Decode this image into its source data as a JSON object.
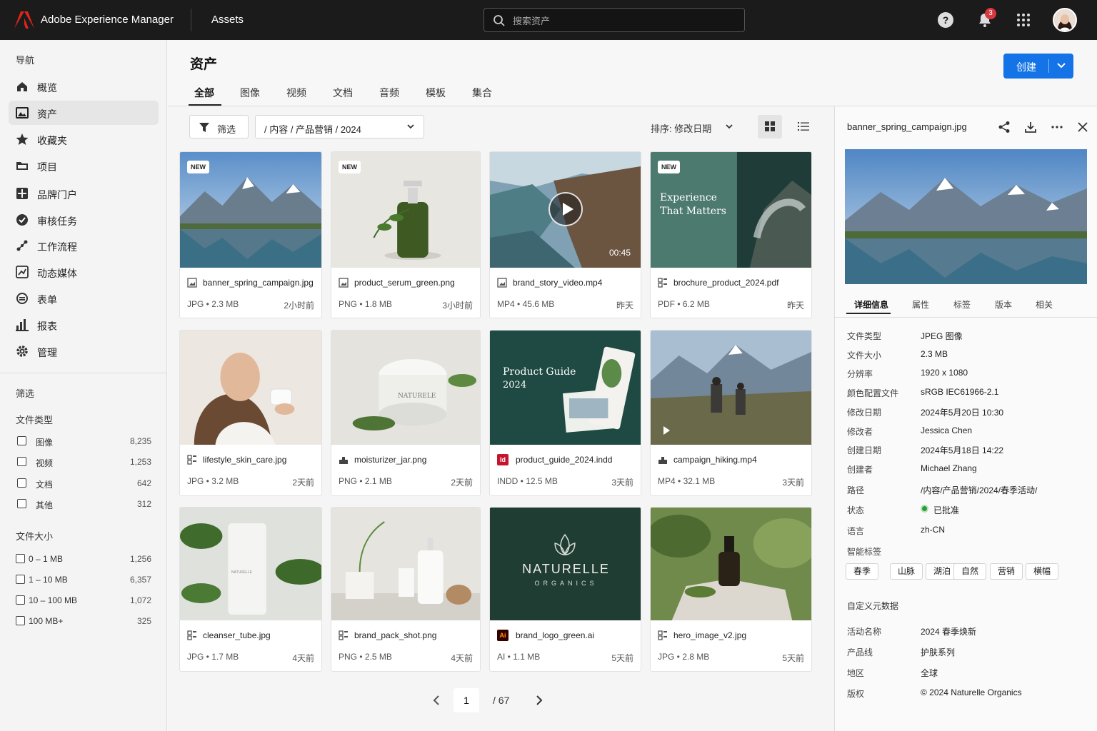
{
  "topbar": {
    "brand": "Adobe Experience Manager",
    "app": "Assets",
    "search_placeholder": "搜索资产",
    "help": "?",
    "notifications": "3"
  },
  "sidebar": {
    "nav_title": "导航",
    "nav": [
      {
        "label": "概览",
        "icon": "overview-icon"
      },
      {
        "label": "资产",
        "icon": "assets-icon"
      },
      {
        "label": "收藏夹",
        "icon": "star-icon"
      },
      {
        "label": "项目",
        "icon": "folder-icon"
      },
      {
        "label": "品牌门户",
        "icon": "brand-portal-icon"
      },
      {
        "label": "审核任务",
        "icon": "check-circle-icon"
      },
      {
        "label": "工作流程",
        "icon": "workflow-icon"
      },
      {
        "label": "动态媒体",
        "icon": "dynamic-media-icon"
      },
      {
        "label": "表单",
        "icon": "form-icon"
      },
      {
        "label": "报表",
        "icon": "report-icon"
      },
      {
        "label": "管理",
        "icon": "gear-icon"
      }
    ],
    "filter_title": "筛选",
    "file_type_title": "文件类型",
    "file_types": [
      {
        "label": "图像",
        "count": "8,235"
      },
      {
        "label": "视频",
        "count": "1,253"
      },
      {
        "label": "文档",
        "count": "642"
      },
      {
        "label": "其他",
        "count": "312"
      }
    ],
    "file_size_title": "文件大小",
    "file_sizes": [
      {
        "label": "0 – 1 MB",
        "count": "1,256"
      },
      {
        "label": "1 – 10 MB",
        "count": "6,357"
      },
      {
        "label": "10 – 100 MB",
        "count": "1,072"
      },
      {
        "label": "100 MB+",
        "count": "325"
      }
    ]
  },
  "header": {
    "title": "资产",
    "create": "创建",
    "tabs": [
      "全部",
      "图像",
      "视频",
      "文档",
      "音频",
      "模板",
      "集合"
    ]
  },
  "toolbar": {
    "filter": "筛选",
    "path": "/ 内容 / 产品营销 / 2024",
    "sort": "排序:  修改日期"
  },
  "assets": [
    {
      "name": "banner_spring_campaign.jpg",
      "type": "JPG",
      "size": "2.3 MB",
      "time": "2小时前",
      "badge": "NEW"
    },
    {
      "name": "product_serum_green.png",
      "type": "PNG",
      "size": "1.8 MB",
      "time": "3小时前",
      "badge": "NEW"
    },
    {
      "name": "brand_story_video.mp4",
      "type": "MP4",
      "size": "45.6 MB",
      "time": "昨天",
      "duration": "00:45"
    },
    {
      "name": "brochure_product_2024.pdf",
      "type": "PDF",
      "size": "6.2 MB",
      "time": "昨天",
      "badge": "NEW",
      "thumb_text": [
        "Experience",
        "That Matters"
      ]
    },
    {
      "name": "lifestyle_skin_care.jpg",
      "type": "JPG",
      "size": "3.2 MB",
      "time": "2天前"
    },
    {
      "name": "moisturizer_jar.png",
      "type": "PNG",
      "size": "2.1 MB",
      "time": "2天前",
      "thumb_text": [
        "NATURELE"
      ]
    },
    {
      "name": "product_guide_2024.indd",
      "type": "INDD",
      "size": "12.5 MB",
      "time": "3天前",
      "thumb_text": [
        "Product Guide",
        "2024"
      ],
      "icon_text": "Id"
    },
    {
      "name": "campaign_hiking.mp4",
      "type": "MP4",
      "size": "32.1 MB",
      "time": "3天前"
    },
    {
      "name": "cleanser_tube.jpg",
      "type": "JPG",
      "size": "1.7 MB",
      "time": "4天前",
      "thumb_text": [
        "NATURELLE"
      ]
    },
    {
      "name": "brand_pack_shot.png",
      "type": "PNG",
      "size": "2.5 MB",
      "time": "4天前"
    },
    {
      "name": "brand_logo_green.ai",
      "type": "AI",
      "size": "1.1 MB",
      "time": "5天前",
      "thumb_text": [
        "NATURELLE",
        "ORGANICS"
      ],
      "icon_text": "Ai"
    },
    {
      "name": "hero_image_v2.jpg",
      "type": "JPG",
      "size": "2.8 MB",
      "time": "5天前"
    }
  ],
  "pagination": {
    "current": "1",
    "total": "/   67"
  },
  "details": {
    "file_name": "banner_spring_campaign.jpg",
    "tabs": [
      "详细信息",
      "属性",
      "标签",
      "版本",
      "相关"
    ],
    "props": [
      {
        "k": "文件类型",
        "v": "JPEG 图像"
      },
      {
        "k": "文件大小",
        "v": "2.3 MB"
      },
      {
        "k": "分辨率",
        "v": "1920 x 1080"
      },
      {
        "k": "颜色配置文件",
        "v": "sRGB IEC61966-2.1"
      },
      {
        "k": "修改日期",
        "v": "2024年5月20日 10:30"
      },
      {
        "k": "修改者",
        "v": "Jessica Chen"
      },
      {
        "k": "创建日期",
        "v": "2024年5月18日 14:22"
      },
      {
        "k": "创建者",
        "v": "Michael Zhang"
      },
      {
        "k": "路径",
        "v": "/内容/产品营销/2024/春季活动/"
      },
      {
        "k": "状态",
        "v": "已批准"
      },
      {
        "k": "语言",
        "v": "zh-CN"
      }
    ],
    "smart_tags_title": "智能标签",
    "smart_tags": [
      "春季",
      "山脉",
      "湖泊",
      "自然",
      "营销",
      "横幅"
    ],
    "custom_title": "自定义元数据",
    "custom": [
      {
        "k": "活动名称",
        "v": "2024 春季焕新"
      },
      {
        "k": "产品线",
        "v": "护肤系列"
      },
      {
        "k": "地区",
        "v": "全球"
      },
      {
        "k": "版权",
        "v": "© 2024 Naturelle Organics"
      }
    ],
    "status_color": "#2d9d3a"
  },
  "colors": {
    "accent": "#1473e6",
    "topbar": "#1b1b1b",
    "badge": "#d7373f"
  }
}
